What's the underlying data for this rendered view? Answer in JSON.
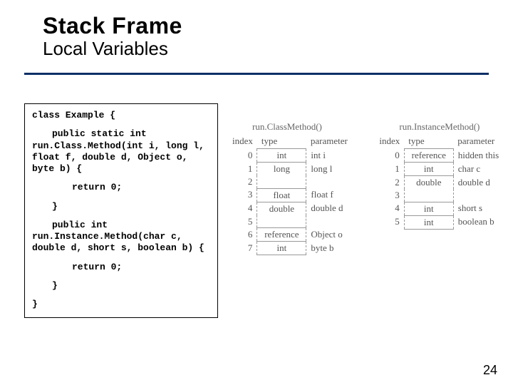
{
  "title": {
    "main": "Stack Frame",
    "sub": "Local Variables"
  },
  "code": {
    "l0": "class Example {",
    "m1": {
      "sig1": "public static int",
      "sig2": "run.Class.Method(int i, long l, float f, double d, Object o, byte b) {",
      "ret": "return 0;",
      "close": "}"
    },
    "m2": {
      "sig1": "public int",
      "sig2": "run.Instance.Method(char c, double d, short s, boolean b) {",
      "ret": "return 0;",
      "close": "}"
    },
    "lend": "}"
  },
  "diagram": {
    "headers": {
      "index": "index",
      "type": "type",
      "param": "parameter"
    },
    "left": {
      "title": "run.ClassMethod()",
      "rows": [
        {
          "index": "0",
          "type": "int",
          "param": "int i"
        },
        {
          "index": "1",
          "type": "long",
          "param": "long l"
        },
        {
          "index": "2",
          "type": "",
          "param": ""
        },
        {
          "index": "3",
          "type": "float",
          "param": "float f"
        },
        {
          "index": "4",
          "type": "double",
          "param": "double d"
        },
        {
          "index": "5",
          "type": "",
          "param": ""
        },
        {
          "index": "6",
          "type": "reference",
          "param": "Object o"
        },
        {
          "index": "7",
          "type": "int",
          "param": "byte b"
        }
      ]
    },
    "right": {
      "title": "run.InstanceMethod()",
      "rows": [
        {
          "index": "0",
          "type": "reference",
          "param": "hidden this"
        },
        {
          "index": "1",
          "type": "int",
          "param": "char c"
        },
        {
          "index": "2",
          "type": "double",
          "param": "double d"
        },
        {
          "index": "3",
          "type": "",
          "param": ""
        },
        {
          "index": "4",
          "type": "int",
          "param": "short s"
        },
        {
          "index": "5",
          "type": "int",
          "param": "boolean b"
        }
      ]
    }
  },
  "page": "24"
}
